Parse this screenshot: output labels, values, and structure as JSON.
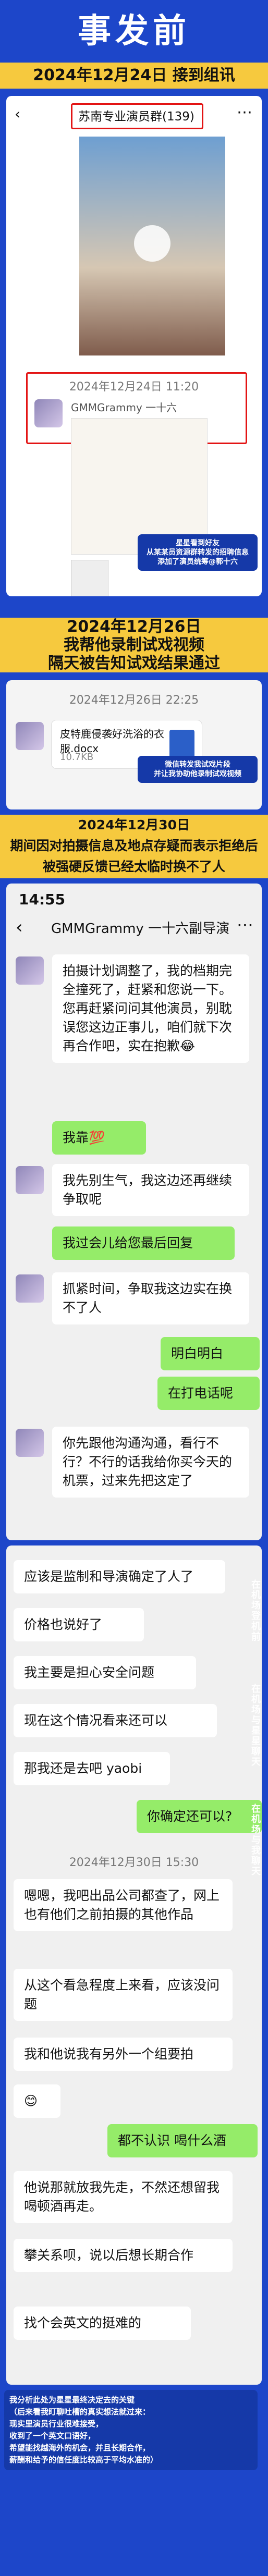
{
  "header": {
    "title": "事发前",
    "date1": "2024年12月24日 接到组讯"
  },
  "group": {
    "name": "苏南专业演员群(139)",
    "timestamp": "2024年12月24日 11:20",
    "sender": "GMMGrammy 一十六",
    "note": "星星看到好友\n从某某员资源群转发的招聘信息\n添加了演员统筹@郭十六"
  },
  "section2": {
    "heading": "2024年12月26日\n我帮他录制试戏视频\n隔天被告知试戏结果通过",
    "file_name": "皮特鹿侵袭好洗浴的衣服.docx",
    "file_size": "10.7KB",
    "file_date": "2024年12月26日 22:25",
    "note": "微信转发我试戏片段\n并让我协助他录制试戏视频"
  },
  "section3": {
    "heading": "2024年12月30日\n期间因对拍摄信息及地点存疑而表示拒绝后\n被强硬反馈已经太临时换不了人",
    "status_time": "14:55",
    "chat_title": "GMMGrammy 一十六副导演",
    "messages": [
      {
        "side": "left",
        "text": "拍摄计划调整了，我的档期完全撞死了，赶紧和您说一下。您再赶紧问问其他演员，别耽误您这边正事儿，咱们就下次再合作吧，实在抱歉😂"
      },
      {
        "side": "right",
        "text": "我靠💯"
      },
      {
        "side": "left",
        "text": "我先别生气，我这边还再继续争取呢"
      },
      {
        "side": "right",
        "text": "我过会儿给您最后回复"
      },
      {
        "side": "left",
        "text": "抓紧时间，争取我这边实在换不了人"
      },
      {
        "side": "right",
        "text": "明白明白"
      },
      {
        "side": "right",
        "text": "在打电话呢"
      },
      {
        "side": "left",
        "text": "你先跟他沟通沟通，看行不行？不行的话我给你买今天的机票，过来先把这定了"
      }
    ]
  },
  "section4": {
    "messages": [
      {
        "side": "left",
        "text": "应该是监制和导演确定了人了"
      },
      {
        "side": "left",
        "text": "价格也说好了"
      },
      {
        "side": "left",
        "text": "我主要是担心安全问题"
      },
      {
        "side": "left",
        "text": "现在这个情况看来还可以"
      },
      {
        "side": "left",
        "text": "那我还是去吧 yaobi"
      },
      {
        "side": "right",
        "text": "你确定还可以?"
      }
    ],
    "timestamp": "2024年12月30日 15:30",
    "messages2": [
      {
        "side": "left",
        "text": "嗯嗯，我吧出品公司都查了，网上也有他们之前拍摄的其他作品"
      },
      {
        "side": "left",
        "text": "从这个看急程度上来看，应该没问题"
      },
      {
        "side": "left",
        "text": "我和他说我有另外一个组要拍"
      },
      {
        "side": "left",
        "text": "😊"
      },
      {
        "side": "right",
        "text": "都不认识 喝什么酒"
      },
      {
        "side": "left",
        "text": "他说那就放我先走，不然还想留我喝顿酒再走。"
      },
      {
        "side": "left",
        "text": "攀关系呗，说以后想长期合作"
      },
      {
        "side": "left",
        "text": "找个会英文的挺难的"
      }
    ],
    "side_label_1": "在机场登机前",
    "side_label_2": "在机场与星星聊天",
    "side_label_3": "在机场与我聊天"
  },
  "footer_note": "我分析此处为星星最终决定去的关键\n（后来看我盯聊吐槽的真实想法就过来：\n现实里演员行业很难接受，\n收到了一个英文口语好，\n希望能找越海外的机会，并且长期合作，\n薪酬和给予的信任度比较高于平均水准的）"
}
